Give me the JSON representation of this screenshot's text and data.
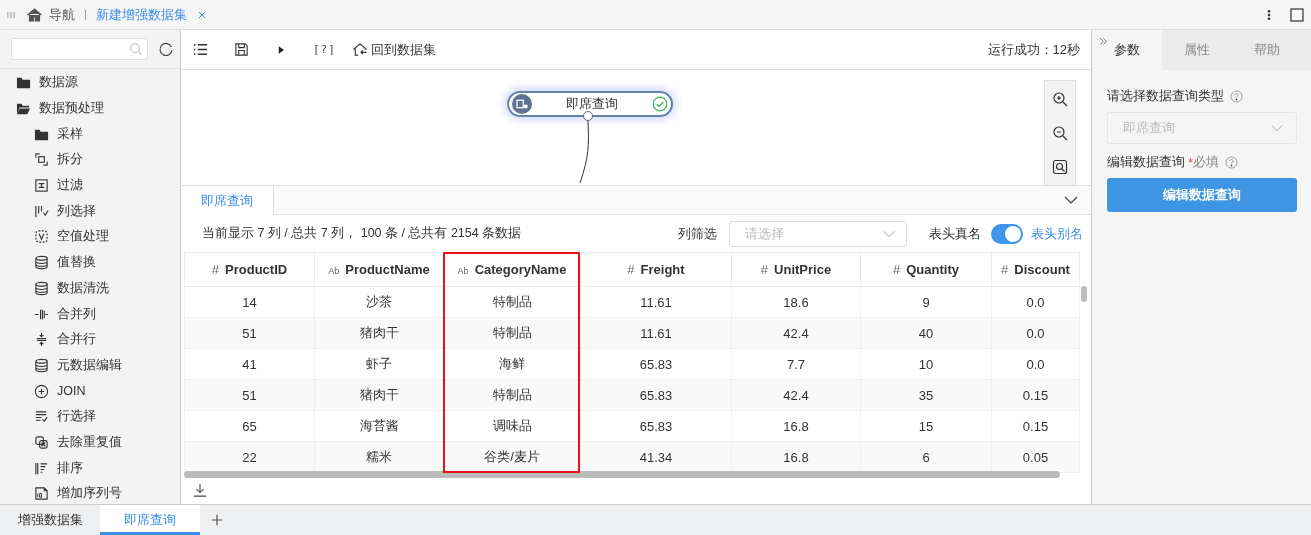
{
  "top_bar": {
    "nav_label": "导航",
    "tabs": [
      {
        "label": "新建增强数据集",
        "selected": true
      }
    ]
  },
  "sidebar": {
    "tree": [
      {
        "label": "数据源",
        "kind": "folder",
        "expanded": false
      },
      {
        "label": "数据预处理",
        "kind": "folder",
        "expanded": true,
        "children": [
          {
            "label": "采样",
            "kind": "folder"
          },
          {
            "label": "拆分",
            "kind": "split"
          },
          {
            "label": "过滤",
            "kind": "filter"
          },
          {
            "label": "列选择",
            "kind": "columns"
          },
          {
            "label": "空值处理",
            "kind": "null"
          },
          {
            "label": "值替换",
            "kind": "db"
          },
          {
            "label": "数据清洗",
            "kind": "db"
          },
          {
            "label": "合并列",
            "kind": "mergecol"
          },
          {
            "label": "合并行",
            "kind": "mergerow"
          },
          {
            "label": "元数据编辑",
            "kind": "db"
          },
          {
            "label": "JOIN",
            "kind": "join"
          },
          {
            "label": "行选择",
            "kind": "rows"
          },
          {
            "label": "去除重复值",
            "kind": "dedupe"
          },
          {
            "label": "排序",
            "kind": "sort"
          },
          {
            "label": "增加序列号",
            "kind": "serial"
          }
        ]
      }
    ]
  },
  "toolbar": {
    "help": "[?]",
    "back": "回到数据集",
    "status": "运行成功：12秒"
  },
  "canvas": {
    "node": {
      "label": "即席查询",
      "ok": true
    }
  },
  "result_panel": {
    "tabs": [
      {
        "label": "即席查询",
        "selected": true
      }
    ],
    "summary": "当前显示 7 列 / 总共 7 列， 100 条 / 总共有 2154 条数据",
    "column_filter": {
      "label": "列筛选",
      "placeholder": "请选择"
    },
    "header_toggle": {
      "label": "表头真名",
      "on": true,
      "alt_label": "表头别名"
    },
    "table": {
      "columns": [
        {
          "type_mark": "#",
          "name": "ProductID",
          "highlighted": false
        },
        {
          "type_mark": "Ab",
          "name": "ProductName",
          "highlighted": false
        },
        {
          "type_mark": "Ab",
          "name": "CategoryName",
          "highlighted": true
        },
        {
          "type_mark": "#",
          "name": "Freight",
          "highlighted": false
        },
        {
          "type_mark": "#",
          "name": "UnitPrice",
          "highlighted": false
        },
        {
          "type_mark": "#",
          "name": "Quantity",
          "highlighted": false
        },
        {
          "type_mark": "#",
          "name": "Discount",
          "highlighted": false
        }
      ],
      "rows": [
        [
          "14",
          "沙茶",
          "特制品",
          "11.61",
          "18.6",
          "9",
          "0.0"
        ],
        [
          "51",
          "猪肉干",
          "特制品",
          "11.61",
          "42.4",
          "40",
          "0.0"
        ],
        [
          "41",
          "虾子",
          "海鲜",
          "65.83",
          "7.7",
          "10",
          "0.0"
        ],
        [
          "51",
          "猪肉干",
          "特制品",
          "65.83",
          "42.4",
          "35",
          "0.15"
        ],
        [
          "65",
          "海苔酱",
          "调味品",
          "65.83",
          "16.8",
          "15",
          "0.15"
        ],
        [
          "22",
          "糯米",
          "谷类/麦片",
          "41.34",
          "16.8",
          "6",
          "0.05"
        ]
      ]
    }
  },
  "right_panel": {
    "tabs": [
      {
        "label": "参数",
        "selected": true
      },
      {
        "label": "属性",
        "selected": false
      },
      {
        "label": "帮助",
        "selected": false
      }
    ],
    "query_type_label": "请选择数据查询类型",
    "query_type": {
      "value": "即席查询",
      "disabled": true
    },
    "edit_label": "编辑数据查询",
    "required_mark": "*",
    "required_text": "必填",
    "edit_button": "编辑数据查询"
  },
  "bottom_tabs": [
    {
      "label": "增强数据集",
      "selected": false
    },
    {
      "label": "即席查询",
      "selected": true
    }
  ]
}
